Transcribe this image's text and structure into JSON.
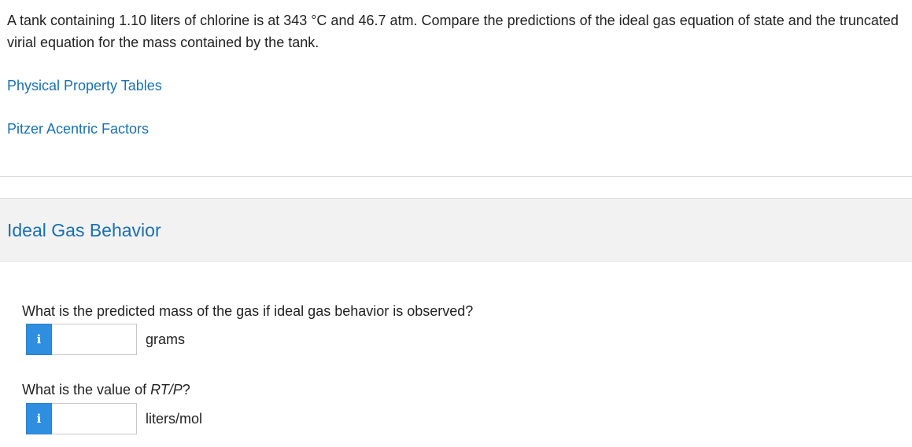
{
  "problem": {
    "text": "A tank containing 1.10 liters of chlorine is at 343 °C and 46.7 atm. Compare the predictions of the ideal gas equation of state and the truncated virial equation for the mass contained by the tank."
  },
  "links": [
    {
      "label": "Physical Property Tables"
    },
    {
      "label": "Pitzer Acentric Factors"
    }
  ],
  "section": {
    "title": "Ideal Gas Behavior"
  },
  "questions": [
    {
      "prompt": "What is the predicted mass of the gas if ideal gas behavior is observed?",
      "info_icon": "i",
      "value": "",
      "unit": "grams"
    },
    {
      "prompt_prefix": "What is the value of ",
      "prompt_italic": "RT/P",
      "prompt_suffix": "?",
      "info_icon": "i",
      "value": "",
      "unit": "liters/mol"
    }
  ],
  "colors": {
    "link": "#1a6fb0",
    "info_button": "#2f8ee0",
    "section_bg": "#f2f2f2"
  }
}
